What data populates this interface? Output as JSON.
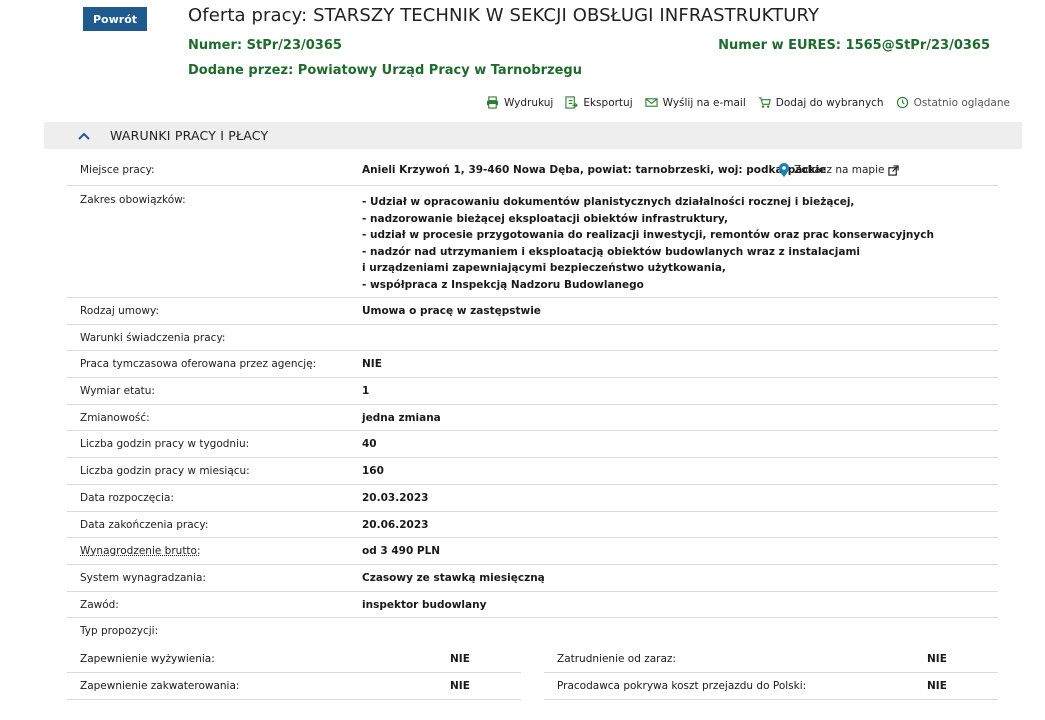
{
  "header": {
    "back_label": "Powrót",
    "title": "Oferta pracy: STARSZY TECHNIK W SEKCJI OBSŁUGI INFRASTRUKTURY",
    "numer_label": "Numer: ",
    "numer_value": "StPr/23/0365",
    "eures_label": "Numer w EURES: ",
    "eures_value": "1565@StPr/23/0365",
    "added_label": "Dodane przez: ",
    "added_value": "Powiatowy Urząd Pracy w Tarnobrzegu"
  },
  "toolbar": {
    "print": "Wydrukuj",
    "export": "Eksportuj",
    "email": "Wyślij na e-mail",
    "favorites": "Dodaj do wybranych",
    "recent": "Ostatnio oglądane"
  },
  "section": {
    "title": "WARUNKI PRACY I PŁACY"
  },
  "details": {
    "miejsce": {
      "label": "Miejsce pracy:",
      "value": "Anieli Krzywoń 1, 39-460 Nowa Dęba, powiat: tarnobrzeski, woj: podkarpackie",
      "map_label": "Zobacz na mapie"
    },
    "zakres": {
      "label": "Zakres obowiązków:",
      "lines": [
        "- Udział w opracowaniu dokumentów planistycznych działalności rocznej i bieżącej,",
        "- nadzorowanie bieżącej eksploatacji obiektów infrastruktury,",
        "- udział w procesie przygotowania do realizacji inwestycji, remontów oraz prac konserwacyjnych",
        "- nadzór nad utrzymaniem i eksploatacją obiektów budowlanych wraz z instalacjami",
        "i urządzeniami zapewniającymi bezpieczeństwo użytkowania,",
        "- współpraca z Inspekcją Nadzoru Budowlanego"
      ]
    },
    "rows": [
      {
        "label": "Rodzaj umowy:",
        "value": "Umowa o pracę w zastępstwie"
      },
      {
        "label": "Warunki świadczenia pracy:",
        "value": ""
      },
      {
        "label": "Praca tymczasowa oferowana przez agencję:",
        "value": "NIE"
      },
      {
        "label": "Wymiar etatu:",
        "value": "1"
      },
      {
        "label": "Zmianowość:",
        "value": "jedna zmiana"
      },
      {
        "label": "Liczba godzin pracy w tygodniu:",
        "value": "40"
      },
      {
        "label": "Liczba godzin pracy w miesiącu:",
        "value": "160"
      },
      {
        "label": "Data rozpoczęcia:",
        "value": "20.03.2023"
      },
      {
        "label": "Data zakończenia pracy:",
        "value": "20.06.2023"
      },
      {
        "label": "Wynagrodzenie brutto:",
        "value": "od 3 490 PLN"
      },
      {
        "label": "System wynagradzania:",
        "value": "Czasowy ze stawką miesięczną"
      },
      {
        "label": "Zawód:",
        "value": "inspektor budowlany"
      },
      {
        "label": "Typ propozycji:",
        "value": ""
      }
    ],
    "extras": [
      {
        "label": "Zapewnienie wyżywienia:",
        "value": "NIE"
      },
      {
        "label": "Zatrudnienie od zaraz:",
        "value": "NIE"
      },
      {
        "label": "Zapewnienie zakwaterowania:",
        "value": "NIE"
      },
      {
        "label": "Pracodawca pokrywa koszt przejazdu do Polski:",
        "value": "NIE"
      }
    ]
  },
  "colors": {
    "accent_green": "#1f6b2d",
    "button_blue": "#1f5a8f",
    "section_bg": "#eeeeee"
  }
}
